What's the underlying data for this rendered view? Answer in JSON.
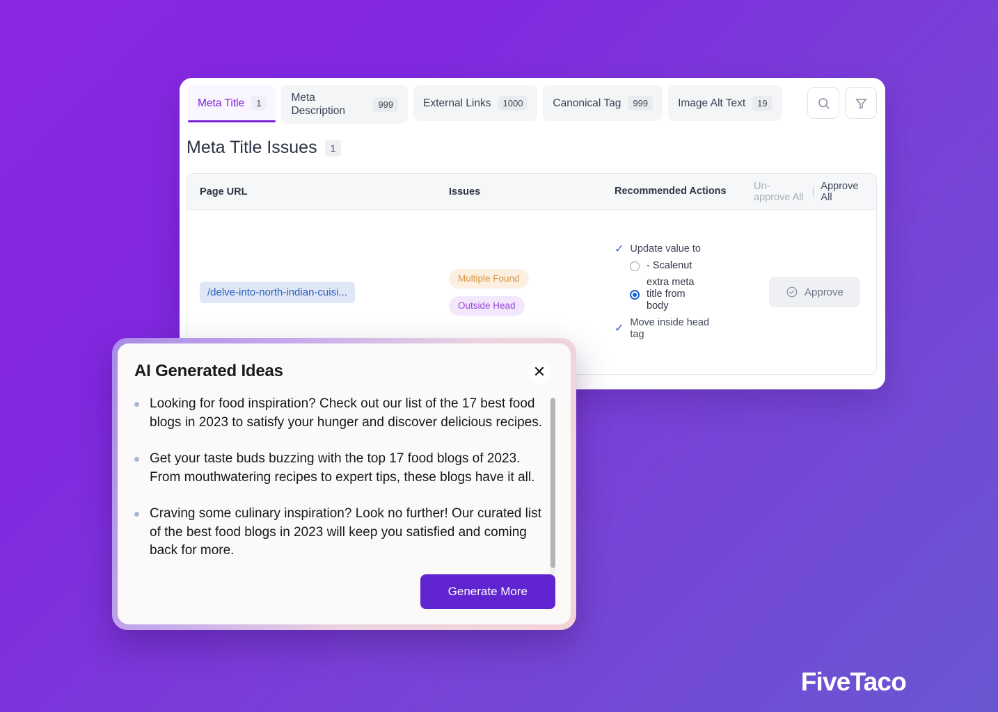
{
  "background": {
    "gradient_from": "#8a28e2",
    "gradient_to": "#6a56d1"
  },
  "tabs": [
    {
      "label": "Meta Title",
      "badge": "1",
      "active": true
    },
    {
      "label": "Meta Description",
      "badge": "999",
      "active": false
    },
    {
      "label": "External Links",
      "badge": "1000",
      "active": false
    },
    {
      "label": "Canonical Tag",
      "badge": "999",
      "active": false
    },
    {
      "label": "Image Alt Text",
      "badge": "19",
      "active": false
    }
  ],
  "toolbar": {
    "search_icon": "search-icon",
    "filter_icon": "filter-icon"
  },
  "page": {
    "title": "Meta Title Issues",
    "count": "1"
  },
  "table": {
    "headers": {
      "page_url": "Page URL",
      "issues": "Issues",
      "recommended_actions": "Recommended Actions"
    },
    "bulk_actions": {
      "unapprove_all": "Un-approve All",
      "separator": "|",
      "approve_all": "Approve All"
    },
    "rows": [
      {
        "url": "/delve-into-north-indian-cuisi...",
        "issues": [
          {
            "label": "Multiple Found",
            "tone": "orange"
          },
          {
            "label": "Outside Head",
            "tone": "purple"
          }
        ],
        "recommendations": {
          "update_label": "Update value to",
          "options": [
            {
              "label": "- Scalenut",
              "selected": false
            },
            {
              "label": "extra meta title from body",
              "selected": true
            }
          ],
          "move_label": "Move inside head tag"
        },
        "approve_button": "Approve"
      }
    ]
  },
  "modal": {
    "title": "AI Generated Ideas",
    "close_icon": "close-icon",
    "ideas": [
      "Looking for food inspiration? Check out our list of the 17 best food blogs in 2023 to satisfy your hunger and discover delicious recipes.",
      "Get your taste buds buzzing with the top 17 food blogs of 2023. From mouthwatering recipes to expert tips, these blogs have it all.",
      "Craving some culinary inspiration? Look no further! Our curated list of the best food blogs in 2023 will keep you satisfied and coming back for more."
    ],
    "generate_button": "Generate More",
    "accent_color": "#6024d0"
  },
  "branding": {
    "logo_text": "FiveTaco"
  }
}
